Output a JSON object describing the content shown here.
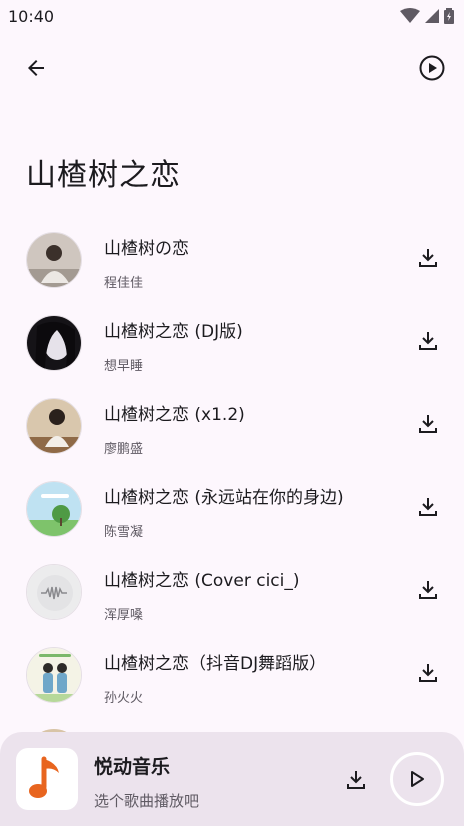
{
  "status_bar": {
    "time": "10:40"
  },
  "page": {
    "title": "山楂树之恋"
  },
  "songs": [
    {
      "title": "山楂树の恋",
      "artist": "程佳佳"
    },
    {
      "title": "山楂树之恋 (DJ版)",
      "artist": "想早睡"
    },
    {
      "title": "山楂树之恋 (x1.2)",
      "artist": "廖鹏盛"
    },
    {
      "title": "山楂树之恋 (永远站在你的身边)",
      "artist": "陈雪凝"
    },
    {
      "title": "山楂树之恋 (Cover cici_)",
      "artist": "浑厚嗓"
    },
    {
      "title": "山楂树之恋（抖音DJ舞蹈版）",
      "artist": "孙火火"
    }
  ],
  "mini_player": {
    "app_name": "悦动音乐",
    "subtitle": "选个歌曲播放吧",
    "accent_color": "#e8651f"
  },
  "icons": {
    "back": "arrow-left-icon",
    "play_all": "play-circle-icon",
    "download": "download-icon",
    "music_note": "music-note-icon",
    "play": "play-icon"
  }
}
